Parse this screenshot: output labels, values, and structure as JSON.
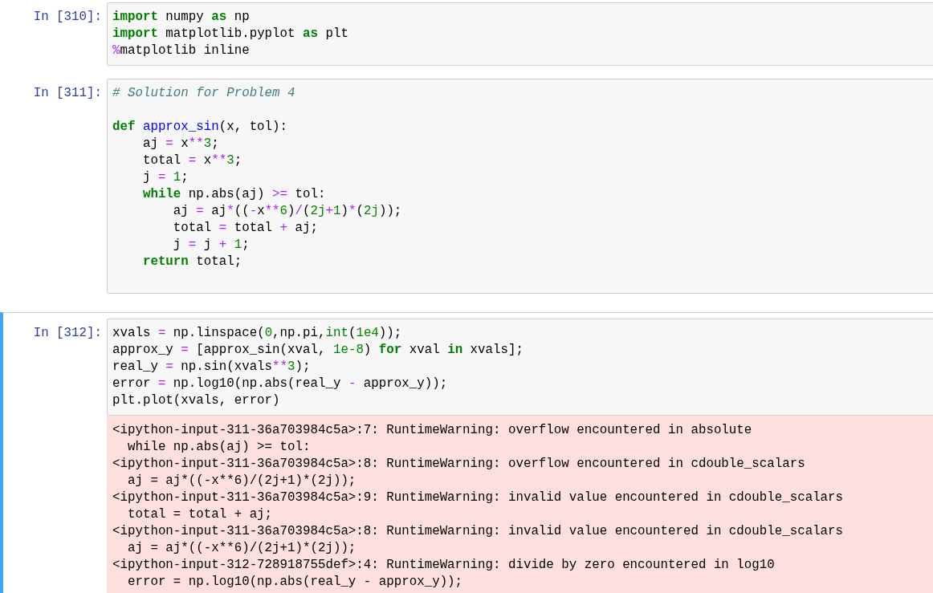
{
  "cells": [
    {
      "prompt": "In [310]:",
      "selected": false,
      "lines": [
        {
          "tokens": [
            {
              "kind": "kw",
              "text": "import"
            },
            {
              "kind": "plain",
              "text": " numpy "
            },
            {
              "kind": "kw",
              "text": "as"
            },
            {
              "kind": "plain",
              "text": " np"
            }
          ]
        },
        {
          "tokens": [
            {
              "kind": "kw",
              "text": "import"
            },
            {
              "kind": "plain",
              "text": " matplotlib.pyplot "
            },
            {
              "kind": "kw",
              "text": "as"
            },
            {
              "kind": "plain",
              "text": " plt"
            }
          ]
        },
        {
          "tokens": [
            {
              "kind": "op",
              "text": "%"
            },
            {
              "kind": "plain",
              "text": "matplotlib inline"
            }
          ]
        }
      ]
    },
    {
      "prompt": "In [311]:",
      "selected": false,
      "lines": [
        {
          "tokens": [
            {
              "kind": "comment",
              "text": "# Solution for Problem 4"
            }
          ]
        },
        {
          "kind": "blank"
        },
        {
          "tokens": [
            {
              "kind": "kw",
              "text": "def "
            },
            {
              "kind": "fn",
              "text": "approx_sin"
            },
            {
              "kind": "plain",
              "text": "(x, tol):"
            }
          ]
        },
        {
          "tokens": [
            {
              "kind": "plain",
              "text": "    aj "
            },
            {
              "kind": "op",
              "text": "="
            },
            {
              "kind": "plain",
              "text": " x"
            },
            {
              "kind": "op",
              "text": "**"
            },
            {
              "kind": "num",
              "text": "3"
            },
            {
              "kind": "plain",
              "text": ";"
            }
          ]
        },
        {
          "tokens": [
            {
              "kind": "plain",
              "text": "    total "
            },
            {
              "kind": "op",
              "text": "="
            },
            {
              "kind": "plain",
              "text": " x"
            },
            {
              "kind": "op",
              "text": "**"
            },
            {
              "kind": "num",
              "text": "3"
            },
            {
              "kind": "plain",
              "text": ";"
            }
          ]
        },
        {
          "tokens": [
            {
              "kind": "plain",
              "text": "    j "
            },
            {
              "kind": "op",
              "text": "= "
            },
            {
              "kind": "num",
              "text": "1"
            },
            {
              "kind": "plain",
              "text": ";"
            }
          ]
        },
        {
          "tokens": [
            {
              "kind": "kw",
              "text": "    while"
            },
            {
              "kind": "plain",
              "text": " np.abs(aj) "
            },
            {
              "kind": "op",
              "text": ">="
            },
            {
              "kind": "plain",
              "text": " tol:"
            }
          ]
        },
        {
          "tokens": [
            {
              "kind": "plain",
              "text": "        aj "
            },
            {
              "kind": "op",
              "text": "="
            },
            {
              "kind": "plain",
              "text": " aj"
            },
            {
              "kind": "op",
              "text": "*"
            },
            {
              "kind": "plain",
              "text": "(("
            },
            {
              "kind": "op",
              "text": "-"
            },
            {
              "kind": "plain",
              "text": "x"
            },
            {
              "kind": "op",
              "text": "**"
            },
            {
              "kind": "num",
              "text": "6"
            },
            {
              "kind": "plain",
              "text": ")"
            },
            {
              "kind": "op",
              "text": "/"
            },
            {
              "kind": "plain",
              "text": "("
            },
            {
              "kind": "num",
              "text": "2j"
            },
            {
              "kind": "op",
              "text": "+"
            },
            {
              "kind": "num",
              "text": "1"
            },
            {
              "kind": "plain",
              "text": ")"
            },
            {
              "kind": "op",
              "text": "*"
            },
            {
              "kind": "plain",
              "text": "("
            },
            {
              "kind": "num",
              "text": "2j"
            },
            {
              "kind": "plain",
              "text": "));"
            }
          ]
        },
        {
          "tokens": [
            {
              "kind": "plain",
              "text": "        total "
            },
            {
              "kind": "op",
              "text": "="
            },
            {
              "kind": "plain",
              "text": " total "
            },
            {
              "kind": "op",
              "text": "+"
            },
            {
              "kind": "plain",
              "text": " aj;"
            }
          ]
        },
        {
          "tokens": [
            {
              "kind": "plain",
              "text": "        j "
            },
            {
              "kind": "op",
              "text": "="
            },
            {
              "kind": "plain",
              "text": " j "
            },
            {
              "kind": "op",
              "text": "+ "
            },
            {
              "kind": "num",
              "text": "1"
            },
            {
              "kind": "plain",
              "text": ";"
            }
          ]
        },
        {
          "tokens": [
            {
              "kind": "kw",
              "text": "    return"
            },
            {
              "kind": "plain",
              "text": " total;"
            }
          ]
        },
        {
          "kind": "blank"
        }
      ]
    },
    {
      "prompt": "In [312]:",
      "selected": true,
      "lines": [
        {
          "tokens": [
            {
              "kind": "plain",
              "text": "xvals "
            },
            {
              "kind": "op",
              "text": "="
            },
            {
              "kind": "plain",
              "text": " np.linspace("
            },
            {
              "kind": "num",
              "text": "0"
            },
            {
              "kind": "plain",
              "text": ",np.pi,"
            },
            {
              "kind": "builtin",
              "text": "int"
            },
            {
              "kind": "plain",
              "text": "("
            },
            {
              "kind": "num",
              "text": "1e4"
            },
            {
              "kind": "plain",
              "text": "));"
            }
          ]
        },
        {
          "tokens": [
            {
              "kind": "plain",
              "text": "approx_y "
            },
            {
              "kind": "op",
              "text": "="
            },
            {
              "kind": "plain",
              "text": " [approx_sin(xval, "
            },
            {
              "kind": "num",
              "text": "1e-8"
            },
            {
              "kind": "plain",
              "text": ") "
            },
            {
              "kind": "kw",
              "text": "for"
            },
            {
              "kind": "plain",
              "text": " xval "
            },
            {
              "kind": "kw",
              "text": "in"
            },
            {
              "kind": "plain",
              "text": " xvals];"
            }
          ]
        },
        {
          "tokens": [
            {
              "kind": "plain",
              "text": "real_y "
            },
            {
              "kind": "op",
              "text": "="
            },
            {
              "kind": "plain",
              "text": " np.sin(xvals"
            },
            {
              "kind": "op",
              "text": "**"
            },
            {
              "kind": "num",
              "text": "3"
            },
            {
              "kind": "plain",
              "text": ");"
            }
          ]
        },
        {
          "tokens": [
            {
              "kind": "plain",
              "text": "error "
            },
            {
              "kind": "op",
              "text": "="
            },
            {
              "kind": "plain",
              "text": " np.log10(np.abs(real_y "
            },
            {
              "kind": "op",
              "text": "-"
            },
            {
              "kind": "plain",
              "text": " approx_y));"
            }
          ]
        },
        {
          "tokens": [
            {
              "kind": "plain",
              "text": "plt.plot(xvals, error)"
            }
          ]
        }
      ],
      "output": {
        "kind": "stderr",
        "lines": [
          "<ipython-input-311-36a703984c5a>:7: RuntimeWarning: overflow encountered in absolute",
          "  while np.abs(aj) >= tol:",
          "<ipython-input-311-36a703984c5a>:8: RuntimeWarning: overflow encountered in cdouble_scalars",
          "  aj = aj*((-x**6)/(2j+1)*(2j));",
          "<ipython-input-311-36a703984c5a>:9: RuntimeWarning: invalid value encountered in cdouble_scalars",
          "  total = total + aj;",
          "<ipython-input-311-36a703984c5a>:8: RuntimeWarning: invalid value encountered in cdouble_scalars",
          "  aj = aj*((-x**6)/(2j+1)*(2j));",
          "<ipython-input-312-728918755def>:4: RuntimeWarning: divide by zero encountered in log10",
          "  error = np.log10(np.abs(real_y - approx_y));"
        ]
      }
    }
  ]
}
